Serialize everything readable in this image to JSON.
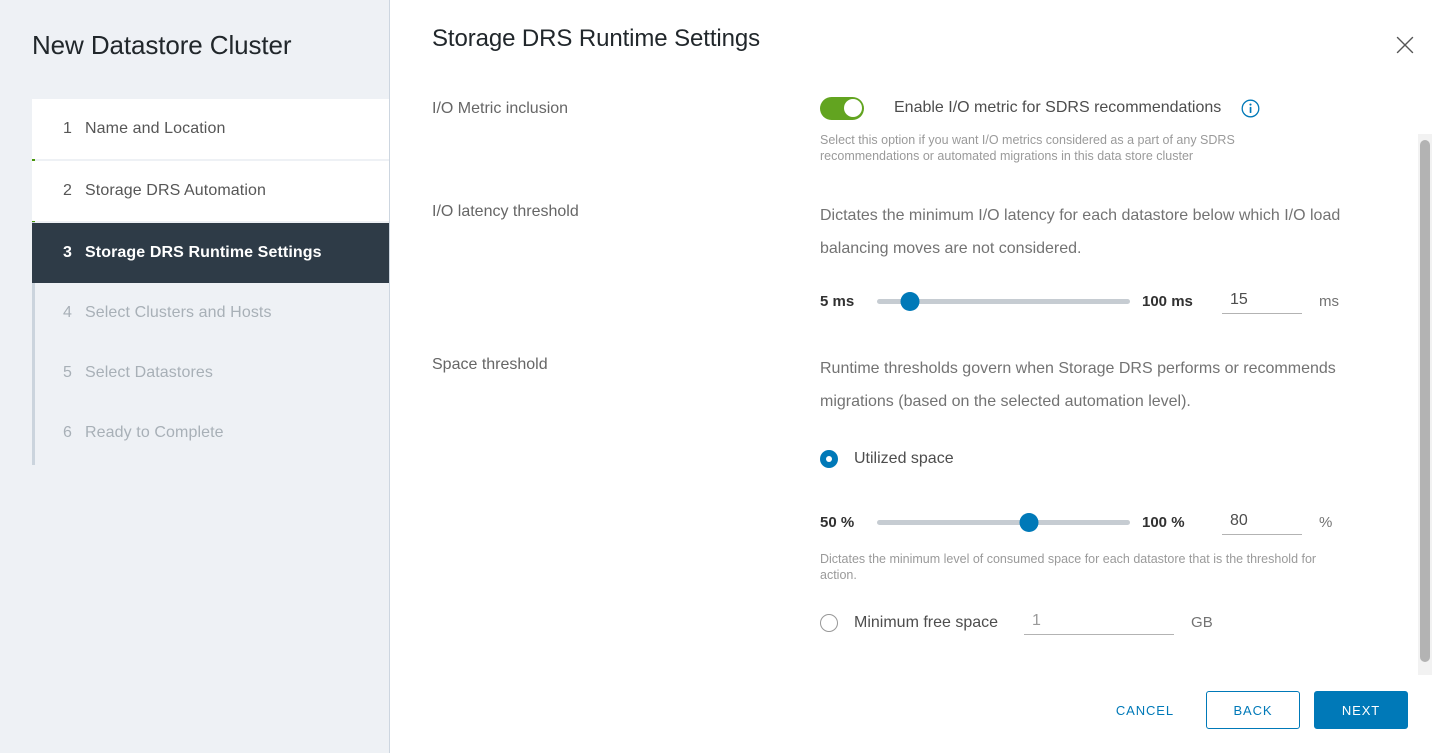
{
  "wizard": {
    "title": "New Datastore Cluster",
    "steps": [
      {
        "num": "1",
        "label": "Name and Location",
        "state": "done"
      },
      {
        "num": "2",
        "label": "Storage DRS Automation",
        "state": "done"
      },
      {
        "num": "3",
        "label": "Storage DRS Runtime Settings",
        "state": "active"
      },
      {
        "num": "4",
        "label": "Select Clusters and Hosts",
        "state": "upcoming"
      },
      {
        "num": "5",
        "label": "Select Datastores",
        "state": "upcoming"
      },
      {
        "num": "6",
        "label": "Ready to Complete",
        "state": "upcoming"
      }
    ]
  },
  "pane": {
    "title": "Storage DRS Runtime Settings",
    "close_icon": "close-icon"
  },
  "io_metric": {
    "label": "I/O Metric inclusion",
    "toggle_state": "on",
    "toggle_label": "Enable I/O metric for SDRS recommendations",
    "info_icon": "info-circle-icon",
    "hint": "Select this option if you want I/O metrics considered as a part of any SDRS recommendations or automated migrations in this data store cluster"
  },
  "io_latency": {
    "label": "I/O latency threshold",
    "description": "Dictates the minimum I/O latency for each datastore below which I/O load balancing moves are not considered.",
    "slider": {
      "min_label": "5 ms",
      "max_label": "100 ms",
      "min": 5,
      "max": 100,
      "value": 15,
      "percent": 13
    },
    "input_value": "15",
    "unit": "ms"
  },
  "space_threshold": {
    "label": "Space threshold",
    "description": "Runtime thresholds govern when Storage DRS performs or recommends migrations (based on the selected automation level).",
    "utilized": {
      "radio_label": "Utilized space",
      "selected": true,
      "slider": {
        "min_label": "50 %",
        "max_label": "100 %",
        "min": 50,
        "max": 100,
        "value": 80,
        "percent": 60
      },
      "input_value": "80",
      "unit": "%",
      "hint": "Dictates the minimum level of consumed space for each datastore that is the threshold for action."
    },
    "minimum_free": {
      "radio_label": "Minimum free space",
      "selected": false,
      "input_value": "1",
      "unit": "GB"
    }
  },
  "footer": {
    "cancel": "CANCEL",
    "back": "BACK",
    "next": "NEXT"
  },
  "colors": {
    "accent_blue": "#0079b8",
    "toggle_green": "#62a420",
    "rail_green": "#48960c",
    "active_step_bg": "#2e3b47",
    "sidebar_bg": "#eef1f5"
  }
}
